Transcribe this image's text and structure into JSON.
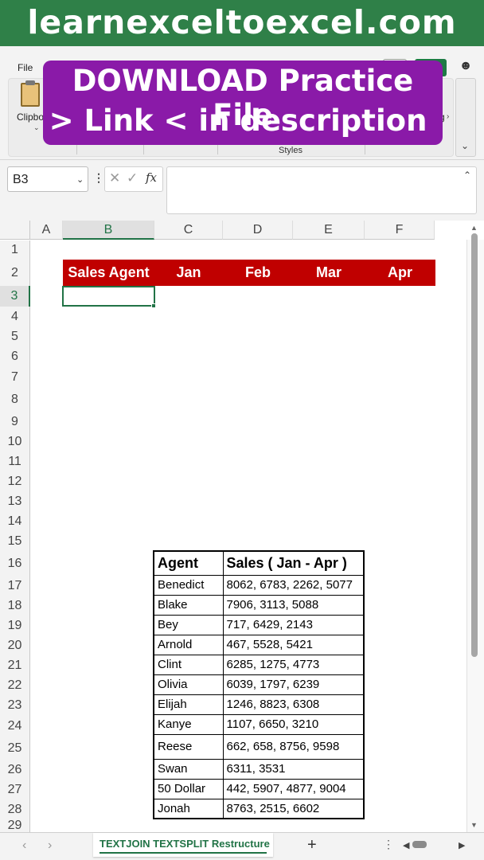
{
  "banner": {
    "text": "learnexceltoexcel.com"
  },
  "ribbon": {
    "file_tab": "File",
    "clipboard_label": "Clipboard",
    "styles_label": "Styles",
    "editing_label": "diting",
    "dropdown_caret": "⌄",
    "editing_chevron": "›"
  },
  "promo": {
    "line1": "DOWNLOAD Practice File",
    "line2": "> Link < in description",
    "color": "#8a1aa8"
  },
  "formula_bar": {
    "name_box": "B3",
    "name_box_caret": "⌄",
    "menu_dots": "⋮",
    "cancel_icon": "✕",
    "enter_icon": "✓",
    "fx": "fx",
    "formula_value": "",
    "expand_icon": "⌃"
  },
  "sheet": {
    "columns": [
      "A",
      "B",
      "C",
      "D",
      "E",
      "F"
    ],
    "rows": [
      "1",
      "2",
      "3",
      "4",
      "5",
      "6",
      "7",
      "8",
      "9",
      "10",
      "11",
      "12",
      "13",
      "14",
      "15",
      "16",
      "17",
      "18",
      "19",
      "20",
      "21",
      "22",
      "23",
      "24",
      "25",
      "26",
      "27",
      "28",
      "29"
    ],
    "active_cell": "B3",
    "header_fill": "#c00000",
    "header_row": [
      "Sales Agent",
      "Jan",
      "Feb",
      "Mar",
      "Apr"
    ],
    "table": {
      "headers": [
        "Agent",
        "Sales ( Jan - Apr )"
      ],
      "rows": [
        [
          "Benedict",
          "8062, 6783, 2262, 5077"
        ],
        [
          "Blake",
          "7906, 3113, 5088"
        ],
        [
          "Bey",
          "717, 6429, 2143"
        ],
        [
          "Arnold",
          "467, 5528, 5421"
        ],
        [
          "Clint",
          "6285, 1275, 4773"
        ],
        [
          "Olivia",
          "6039, 1797, 6239"
        ],
        [
          "Elijah",
          "1246, 8823, 6308"
        ],
        [
          "Kanye",
          "1107, 6650, 3210"
        ],
        [
          "Reese",
          "662, 658, 8756, 9598"
        ],
        [
          "Swan",
          "6311, 3531"
        ],
        [
          "50 Dollar",
          "442, 5907, 4877, 9004"
        ],
        [
          "Jonah",
          "8763, 2515, 6602"
        ]
      ]
    }
  },
  "tabs": {
    "prev": "‹",
    "next": "›",
    "active_sheet": "TEXTJOIN TEXTSPLIT Restructure",
    "add": "+",
    "more": "⋮",
    "scroll_left": "◀",
    "scroll_right": "▶"
  },
  "scrollbar": {
    "up": "▲",
    "down": "▼"
  },
  "colors": {
    "excel_green": "#217346",
    "banner_green": "#2f8048"
  }
}
